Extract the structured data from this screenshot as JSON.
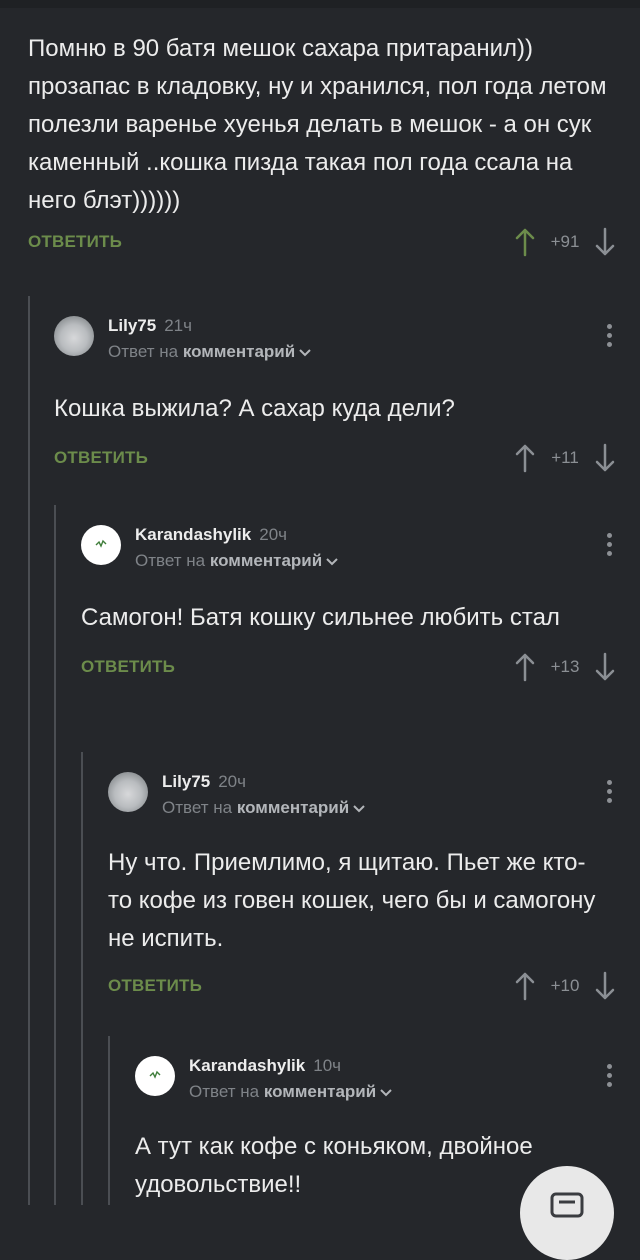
{
  "root_comment": {
    "text": "Помню в 90 батя мешок сахара притаранил)) прозапас в кладовку, ну и хранился, пол года летом полезли варенье хуенья делать в мешок - а он сук каменный ..кошка пизда такая пол года ссала на него блэт))))))",
    "reply_label": "ОТВЕТИТЬ",
    "score": "+91"
  },
  "comments": [
    {
      "username": "Lily75",
      "time": "21ч",
      "reply_prefix": "Ответ на",
      "reply_target": "комментарий",
      "text": "Кошка выжила? А сахар куда дели?",
      "reply_label": "ОТВЕТИТЬ",
      "score": "+11"
    },
    {
      "username": "Karandashylik",
      "time": "20ч",
      "reply_prefix": "Ответ на",
      "reply_target": "комментарий",
      "text": "Самогон! Батя кошку сильнее любить стал",
      "reply_label": "ОТВЕТИТЬ",
      "score": "+13"
    },
    {
      "username": "Lily75",
      "time": "20ч",
      "reply_prefix": "Ответ на",
      "reply_target": "комментарий",
      "text": "Ну что. Приемлимо, я щитаю. Пьет же кто- то кофе из говен кошек, чего бы и самогону не испить.",
      "reply_label": "ОТВЕТИТЬ",
      "score": "+10"
    },
    {
      "username": "Karandashylik",
      "time": "10ч",
      "reply_prefix": "Ответ на",
      "reply_target": "комментарий",
      "text": "А тут как кофе с коньяком, двойное удовольствие!!"
    }
  ],
  "icons": {
    "upvote": "arrow-up-icon",
    "downvote": "arrow-down-icon",
    "more": "more-vertical-icon",
    "chevron": "chevron-down-icon",
    "fab": "compose-icon"
  },
  "colors": {
    "background": "#25272b",
    "reply_green": "#6c8c4b",
    "upvote_active": "#6c8c4b",
    "muted": "#7f8388"
  }
}
